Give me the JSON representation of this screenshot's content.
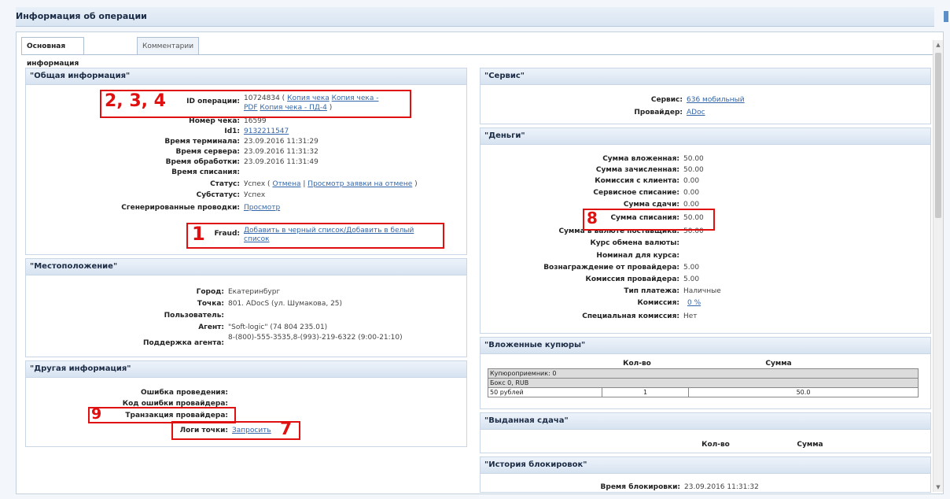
{
  "window_title": "Информация об операции",
  "tabs": [
    "Основная информация",
    "Комментарии"
  ],
  "general": {
    "title": "\"Общая информация\"",
    "id_label": "ID операции:",
    "id_value": "10724834 (",
    "id_links": [
      "Копия чека",
      "Копия чека - PDF",
      "Копия чека - ПД-4"
    ],
    "id_close": ")",
    "check_label": "Номер чека:",
    "check_value": "16599",
    "id1_label": "Id1:",
    "id1_value": "9132211547",
    "terminal_time_label": "Время терминала:",
    "terminal_time": "23.09.2016 11:31:29",
    "server_time_label": "Время сервера:",
    "server_time": "23.09.2016 11:31:32",
    "processing_time_label": "Время обработки:",
    "processing_time": "23.09.2016 11:31:49",
    "writeoff_time_label": "Время списания:",
    "status_label": "Статус:",
    "status_value": "Успех (",
    "status_cancel": "Отмена",
    "status_sep": "|",
    "status_view": "Просмотр заявки на отмене",
    "status_close": ")",
    "substatus_label": "Субстатус:",
    "substatus_value": "Успех",
    "postings_label": "Сгенерированные проводки:",
    "postings_link": "Просмотр",
    "fraud_label": "Fraud:",
    "fraud_link": "Добавить в черный список/Добавить в белый список"
  },
  "location": {
    "title": "\"Местоположение\"",
    "city_label": "Город:",
    "city": "Екатеринбург",
    "point_label": "Точка:",
    "point": "801. ADocS (ул. Шумакова, 25)",
    "users_label": "Пользователь:",
    "agent_label": "Агент:",
    "agent": "\"Soft-logic\" (74 804 235.01)",
    "support_label": "Поддержка агента:",
    "support": "8-(800)-555-3535,8-(993)-219-6322 (9:00-21:10)"
  },
  "other": {
    "title": "\"Другая информация\"",
    "error_label": "Ошибка проведения:",
    "error_code_label": "Код ошибки провайдера:",
    "provider_tx_label": "Транзакция провайдера:",
    "logs_label": "Логи точки:",
    "logs_link": "Запросить"
  },
  "service": {
    "title": "\"Сервис\"",
    "service_label": "Сервис:",
    "service_link": "636 мобильный",
    "provider_label": "Провайдер:",
    "provider_link": "ADoc"
  },
  "money": {
    "title": "\"Деньги\"",
    "rows": [
      {
        "label": "Сумма вложенная:",
        "value": "50.00"
      },
      {
        "label": "Сумма зачисленная:",
        "value": "50.00"
      },
      {
        "label": "Комиссия с клиента:",
        "value": "0.00"
      },
      {
        "label": "Сервисное списание:",
        "value": "0.00"
      },
      {
        "label": "Сумма сдачи:",
        "value": "0.00"
      },
      {
        "label": "Сумма списания:",
        "value": "50.00"
      },
      {
        "label": "Сумма в валюте поставщика:",
        "value": "50.00"
      },
      {
        "label": "Курс обмена валюты:",
        "value": ""
      },
      {
        "label": "Номинал для курса:",
        "value": ""
      },
      {
        "label": "Вознаграждение от провайдера:",
        "value": "5.00"
      },
      {
        "label": "Комиссия провайдера:",
        "value": "5.00"
      },
      {
        "label": "Тип платежа:",
        "value": "Наличные"
      },
      {
        "label": "Комиссия:",
        "value": "0 %"
      },
      {
        "label": "Специальная комиссия:",
        "value": "Нет"
      }
    ]
  },
  "bills": {
    "title": "\"Вложенные купюры\"",
    "col_count": "Кол-во",
    "col_sum": "Сумма",
    "acceptor": "Купюроприемник: 0",
    "box": "Бокс 0, RUB",
    "bill_name": "50 рублей",
    "bill_count": "1",
    "bill_sum": "50.0"
  },
  "change": {
    "title": "\"Выданная сдача\"",
    "col_count": "Кол-во",
    "col_sum": "Сумма"
  },
  "blocks": {
    "title": "\"История блокировок\"",
    "time_label": "Время блокировки:",
    "time_value": "23.09.2016 11:31:32"
  },
  "annotations": {
    "n1": "1",
    "n234": "2, 3, 4",
    "n7": "7",
    "n8": "8",
    "n9": "9"
  },
  "colors": {
    "annotation": "#e01010",
    "link": "#3366aa",
    "header_bg": "#d7e3f1"
  }
}
